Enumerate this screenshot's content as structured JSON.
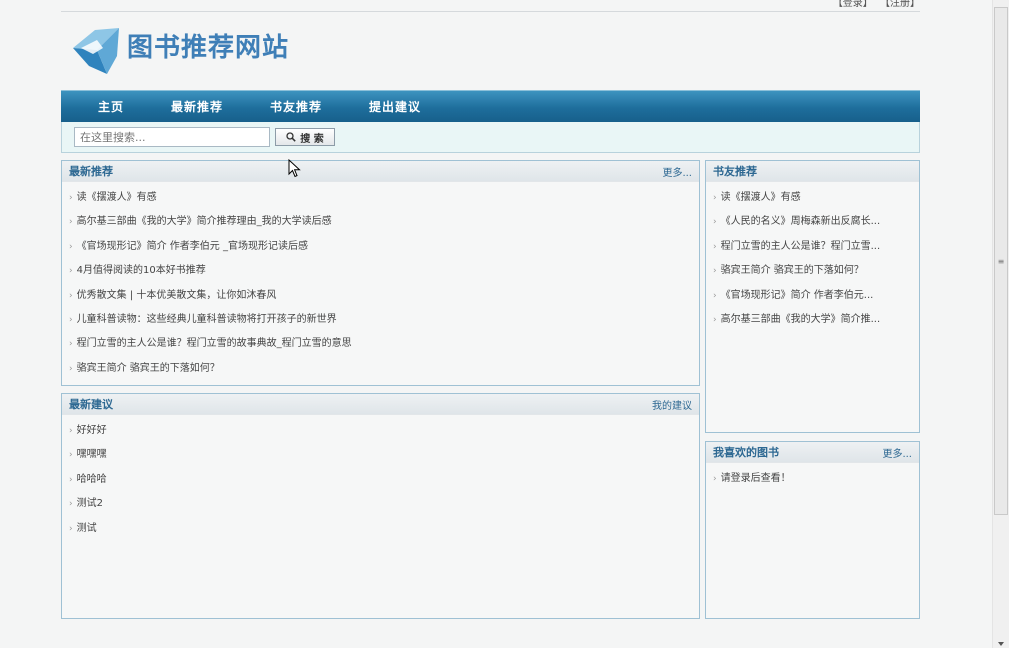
{
  "header": {
    "login": "【登录】",
    "register": "【注册】",
    "logo_text": "图书推荐网站"
  },
  "nav": [
    {
      "label": "主页"
    },
    {
      "label": "最新推荐"
    },
    {
      "label": "书友推荐"
    },
    {
      "label": "提出建议"
    }
  ],
  "search": {
    "placeholder": "在这里搜索...",
    "button_label": "搜 索"
  },
  "latest": {
    "title": "最新推荐",
    "more": "更多...",
    "items": [
      "读《摆渡人》有感",
      "高尔基三部曲《我的大学》简介推荐理由_我的大学读后感",
      "《官场现形记》简介 作者李伯元 _官场现形记读后感",
      "4月值得阅读的10本好书推荐",
      "优秀散文集 | 十本优美散文集，让你如沐春风",
      "儿童科普读物：这些经典儿童科普读物将打开孩子的新世界",
      "程门立雪的主人公是谁？程门立雪的故事典故_程门立雪的意思",
      "骆宾王简介 骆宾王的下落如何？"
    ]
  },
  "suggestions": {
    "title": "最新建议",
    "more": "我的建议",
    "items": [
      "好好好",
      "嘿嘿嘿",
      "哈哈哈",
      "测试2",
      "测试"
    ]
  },
  "friends": {
    "title": "书友推荐",
    "items": [
      "读《摆渡人》有感",
      "《人民的名义》周梅森新出反腐长...",
      "程门立雪的主人公是谁？程门立雪...",
      "骆宾王简介 骆宾王的下落如何？",
      "《官场现形记》简介 作者李伯元...",
      "高尔基三部曲《我的大学》简介推..."
    ]
  },
  "favorites": {
    "title": "我喜欢的图书",
    "more": "更多...",
    "items": [
      "请登录后查看！"
    ]
  }
}
